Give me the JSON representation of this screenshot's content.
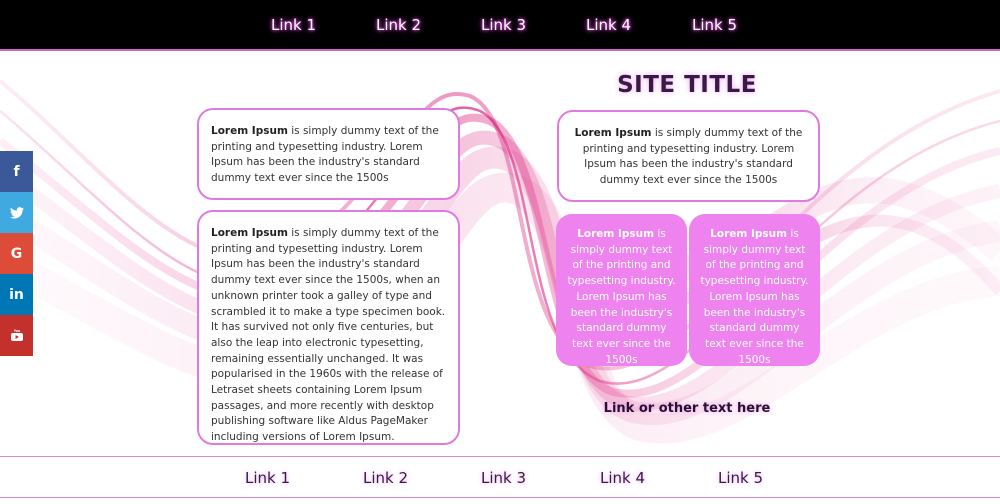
{
  "top_nav": [
    "Link 1",
    "Link 2",
    "Link 3",
    "Link 4",
    "Link 5"
  ],
  "site_title": "SITE TITLE",
  "left_box_short": {
    "bold": "Lorem Ipsum",
    "text": " is simply dummy text of the printing and typesetting industry. Lorem Ipsum has been the industry's standard dummy text ever since the 1500s"
  },
  "left_box_long": {
    "bold": "Lorem Ipsum",
    "text": " is simply dummy text of the printing and typesetting industry. Lorem Ipsum has been the industry's standard dummy text ever since the 1500s, when an unknown printer took a galley of type and scrambled it to make a type specimen book. It has survived not only five centuries, but also the leap into electronic typesetting, remaining essentially unchanged. It was popularised in the 1960s with the release of Letraset sheets containing Lorem Ipsum passages, and more recently with desktop publishing software like Aldus PageMaker including versions of Lorem Ipsum."
  },
  "right_box": {
    "bold": "Lorem Ipsum",
    "text": " is simply dummy text of the printing and typesetting industry. Lorem Ipsum has been the industry's standard dummy text ever since the 1500s"
  },
  "pink_box_left": {
    "bold": "Lorem Ipsum",
    "text": " is simply dummy text of the printing and typesetting industry. Lorem Ipsum has been the industry's standard dummy text ever since the 1500s"
  },
  "pink_box_right": {
    "bold": "Lorem Ipsum",
    "text": " is simply dummy text of the printing and typesetting industry. Lorem Ipsum has been the industry's standard dummy text ever since the 1500s"
  },
  "cta_link": "Link or other text here",
  "footer_nav": [
    "Link 1",
    "Link 2",
    "Link 3",
    "Link 4",
    "Link 5"
  ],
  "social": [
    {
      "icon": "facebook-icon",
      "glyph": "f",
      "color": "#3b5998"
    },
    {
      "icon": "twitter-icon",
      "glyph": "🐦",
      "color": "#3fa9e0"
    },
    {
      "icon": "google-icon",
      "glyph": "G",
      "color": "#dd4b39"
    },
    {
      "icon": "linkedin-icon",
      "glyph": "in",
      "color": "#0077b5"
    },
    {
      "icon": "youtube-icon",
      "glyph": "▶",
      "color": "#c4302b"
    }
  ],
  "colors": {
    "accent": "#ee82ee",
    "border": "#e07ae0",
    "nav_bg": "#000000"
  }
}
